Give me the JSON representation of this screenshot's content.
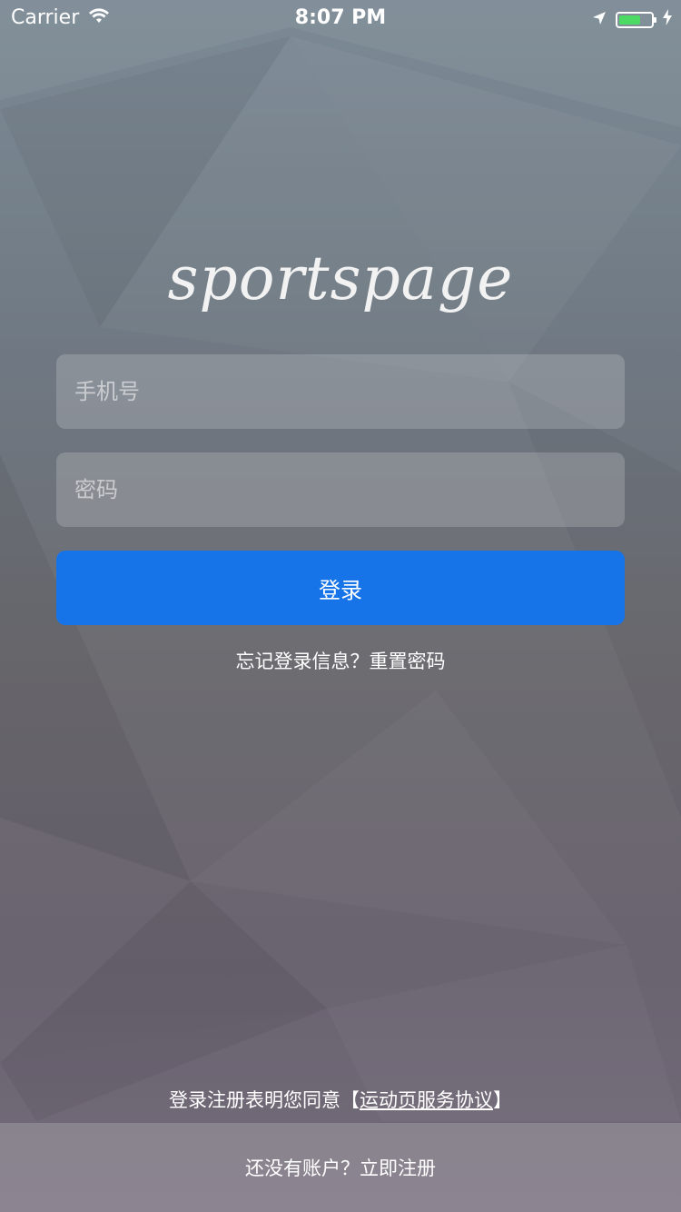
{
  "status_bar": {
    "carrier": "Carrier",
    "time": "8:07 PM",
    "battery_level": 0.7,
    "battery_color": "#4cd964"
  },
  "logo": {
    "text": "sportspage"
  },
  "form": {
    "phone_placeholder": "手机号",
    "password_placeholder": "密码",
    "login_label": "登录",
    "login_color": "#1674e8"
  },
  "forgot_text": "忘记登录信息？重置密码",
  "agreement": {
    "prefix": "登录注册表明您同意【",
    "link": "运动页服务协议",
    "suffix": "】"
  },
  "register_text": "还没有账户？立即注册",
  "icons": [
    "wifi-icon",
    "location-arrow-icon",
    "battery-icon",
    "charging-bolt-icon"
  ]
}
